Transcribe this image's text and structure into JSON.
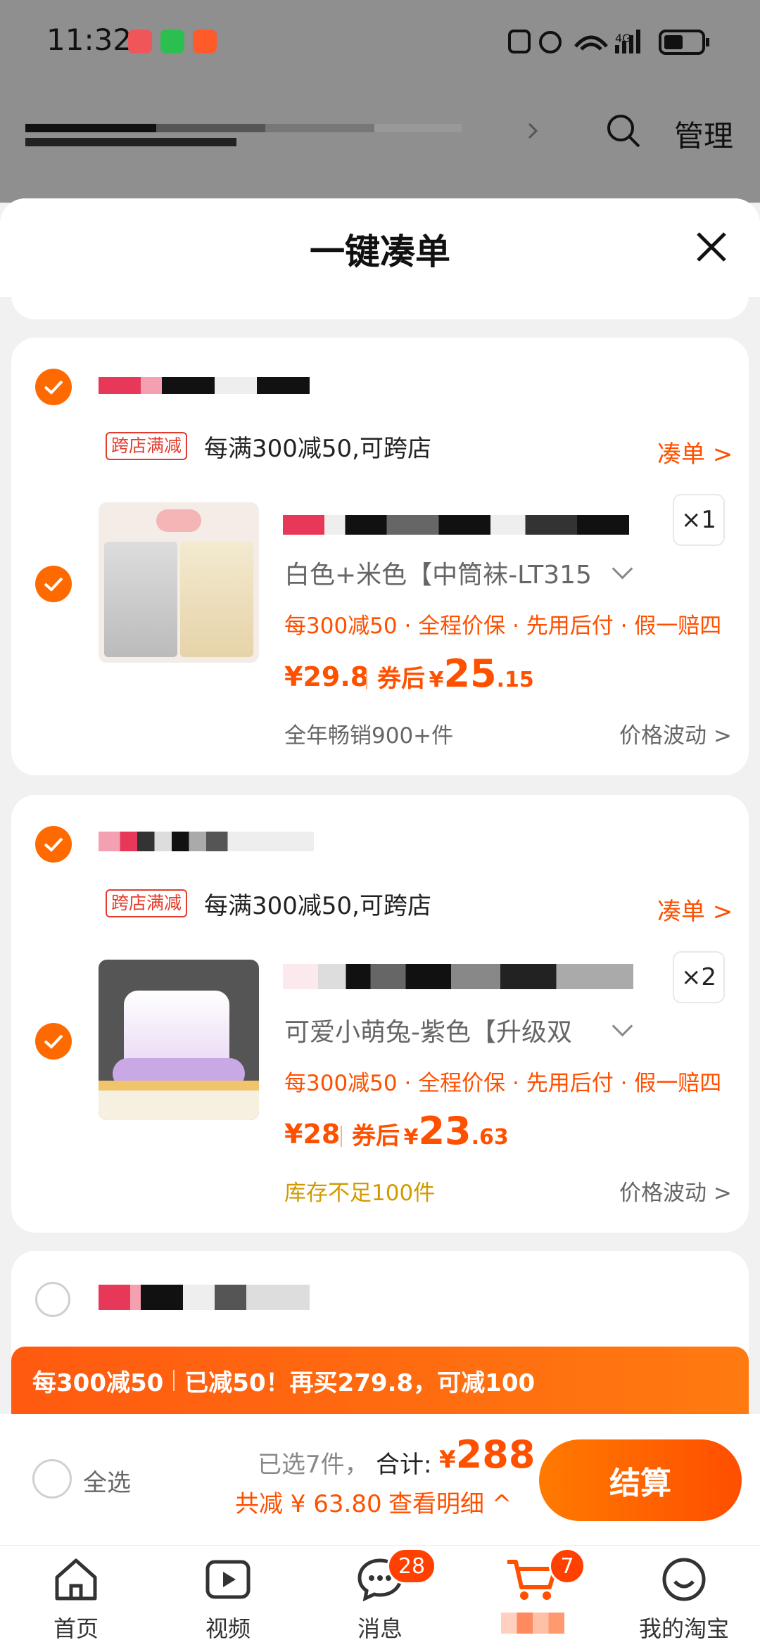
{
  "status_bar": {
    "time": "11:32"
  },
  "header": {
    "manage_label": "管理"
  },
  "sheet": {
    "title": "一键凑单"
  },
  "shops": [
    {
      "promo_tag": "跨店满减",
      "promo_text": "每满300减50,可跨店",
      "coudan_label": "凑单 >",
      "item": {
        "qty": "×1",
        "variant": "白色+米色【中筒袜-LT315",
        "perks": "每300减50 · 全程价保 · 先用后付 · 假一赔四",
        "price": "¥29.8",
        "coupon_label": "券后",
        "coupon_currency": "¥",
        "coupon_int": "25",
        "coupon_dec": ".15",
        "sub_left": "全年畅销900+件",
        "sub_right": "价格波动 >"
      }
    },
    {
      "promo_tag": "跨店满减",
      "promo_text": "每满300减50,可跨店",
      "coudan_label": "凑单 >",
      "item": {
        "qty": "×2",
        "variant": "可爱小萌兔-紫色【升级双",
        "perks": "每300减50 · 全程价保 · 先用后付 · 假一赔四",
        "price": "¥28",
        "coupon_label": "券后",
        "coupon_currency": "¥",
        "coupon_int": "23",
        "coupon_dec": ".63",
        "sub_left": "库存不足100件",
        "sub_right": "价格波动 >"
      }
    }
  ],
  "banner": {
    "left": "每300减50",
    "right": "已减50！再买279.8，可减100"
  },
  "footer": {
    "select_all": "全选",
    "selected_count": "已选7件，",
    "total_label": "合计:",
    "total_currency": "¥",
    "total_value": "288",
    "discount": "共减 ¥ 63.80",
    "detail_link": "查看明细 ^",
    "checkout": "结算"
  },
  "tabbar": {
    "home": "首页",
    "video": "视频",
    "messages": "消息",
    "messages_badge": "28",
    "cart_badge": "7",
    "mine": "我的淘宝"
  },
  "colors": {
    "accent": "#ff5000",
    "check": "#ff6a00",
    "promo_tag": "#e33c2c",
    "stock_warning": "#d19a00"
  }
}
